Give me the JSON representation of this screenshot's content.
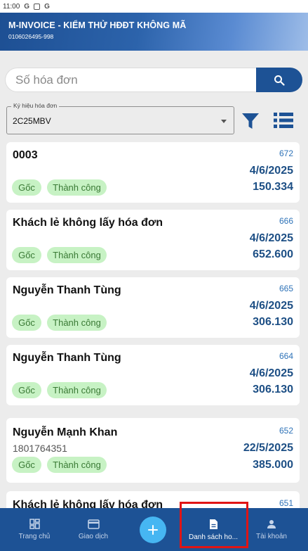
{
  "status_bar": {
    "time": "11:00",
    "icons": [
      "g-icon",
      "a-icon",
      "g-icon"
    ]
  },
  "header": {
    "title": "M-INVOICE - KIỂM THỬ HĐĐT KHÔNG MÃ",
    "subtitle": "0106026495-998"
  },
  "search": {
    "placeholder": "Số hóa đơn",
    "button_icon": "search-icon"
  },
  "filter": {
    "legend": "Ký hiệu hóa đơn",
    "value": "2C25MBV",
    "filter_icon": "funnel-icon",
    "list_icon": "list-icon"
  },
  "invoices": [
    {
      "name": "0003",
      "tax_code": "",
      "number": "672",
      "date": "4/6/2025",
      "amount": "150.334",
      "badge_type": "Gốc",
      "badge_status": "Thành công"
    },
    {
      "name": "Khách lẻ không lấy hóa đơn",
      "tax_code": "",
      "number": "666",
      "date": "4/6/2025",
      "amount": "652.600",
      "badge_type": "Gốc",
      "badge_status": "Thành công"
    },
    {
      "name": "Nguyễn Thanh Tùng",
      "tax_code": "",
      "number": "665",
      "date": "4/6/2025",
      "amount": "306.130",
      "badge_type": "Gốc",
      "badge_status": "Thành công"
    },
    {
      "name": "Nguyễn Thanh Tùng",
      "tax_code": "",
      "number": "664",
      "date": "4/6/2025",
      "amount": "306.130",
      "badge_type": "Gốc",
      "badge_status": "Thành công"
    },
    {
      "name": "Nguyễn Mạnh Khan",
      "tax_code": "1801764351",
      "number": "652",
      "date": "22/5/2025",
      "amount": "385.000",
      "badge_type": "Gốc",
      "badge_status": "Thành công"
    },
    {
      "name": "Khách lẻ không lấy hóa đơn",
      "tax_code": "",
      "number": "651",
      "date": "",
      "amount": "",
      "badge_type": "",
      "badge_status": ""
    }
  ],
  "nav": {
    "items": [
      {
        "label": "Trang chủ",
        "icon": "dashboard-icon"
      },
      {
        "label": "Giao dịch",
        "icon": "credit-card-icon"
      },
      {
        "label": "",
        "icon": "plus-icon"
      },
      {
        "label": "Danh sách ho...",
        "icon": "document-icon"
      },
      {
        "label": "Tài khoản",
        "icon": "person-icon"
      }
    ],
    "active_index": 3
  },
  "colors": {
    "primary": "#1d5295",
    "accent": "#46b6f2",
    "badge_bg": "#c7f2c4",
    "badge_text": "#3a7a35",
    "highlight": "#e11414"
  }
}
